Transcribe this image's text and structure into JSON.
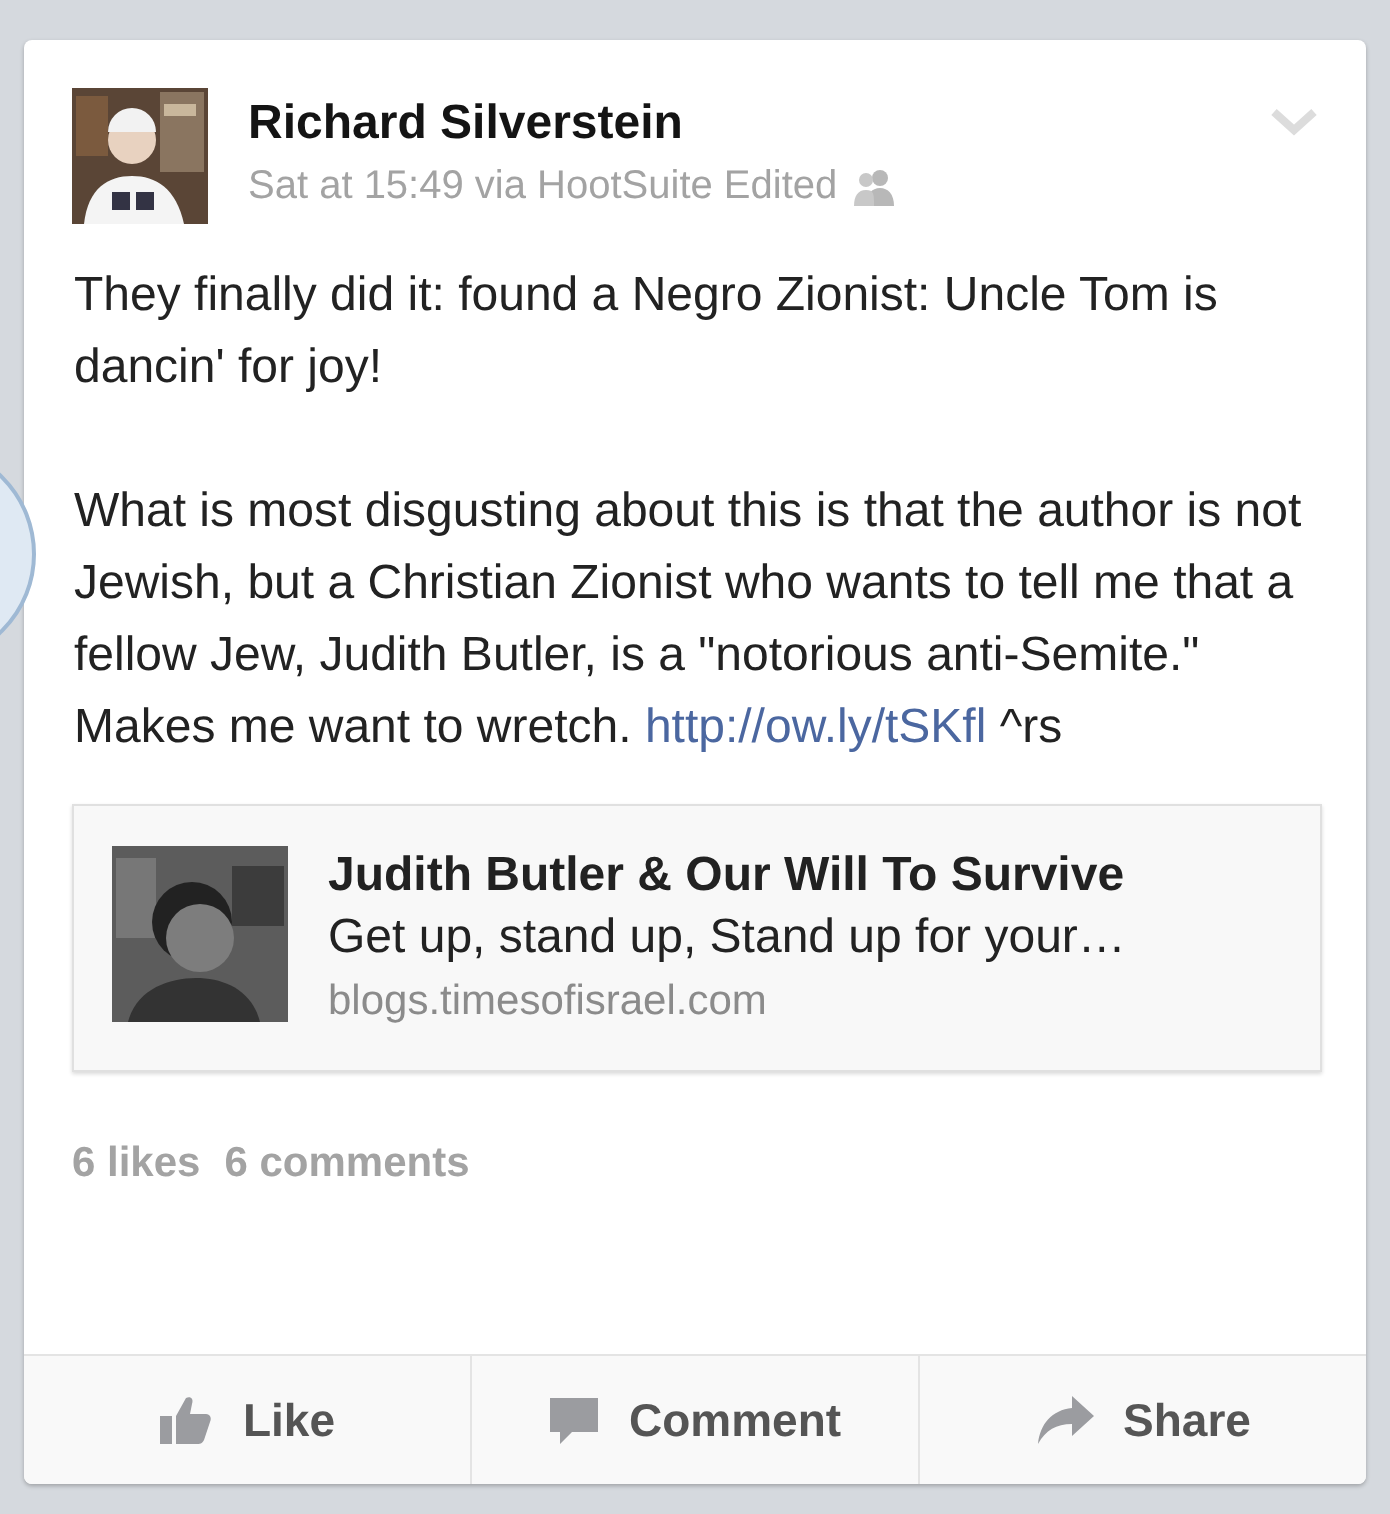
{
  "post": {
    "author": "Richard Silverstein",
    "meta": "Sat at 15:49 via HootSuite Edited",
    "paragraphs": [
      {
        "text": "They finally did it: found a Negro Zionist: Uncle Tom is dancin' for joy!"
      },
      {
        "text": "What is most disgusting about this is that the author is not Jewish, but a Christian Zionist who wants to tell me that a fellow Jew, Judith Butler, is a \"notorious anti-Semite.\"  Makes me want to wretch. ",
        "link": "http://ow.ly/tSKfl",
        "suffix": " ^rs"
      }
    ],
    "link_preview": {
      "title": "Judith Butler & Our Will To Survive",
      "description": "Get up, stand up, Stand up for your…",
      "domain": "blogs.timesofisrael.com"
    },
    "likes": "6 likes",
    "comments": "6 comments",
    "actions": [
      {
        "kind": "like",
        "label": "Like"
      },
      {
        "kind": "comment",
        "label": "Comment"
      },
      {
        "kind": "share",
        "label": "Share"
      }
    ]
  }
}
